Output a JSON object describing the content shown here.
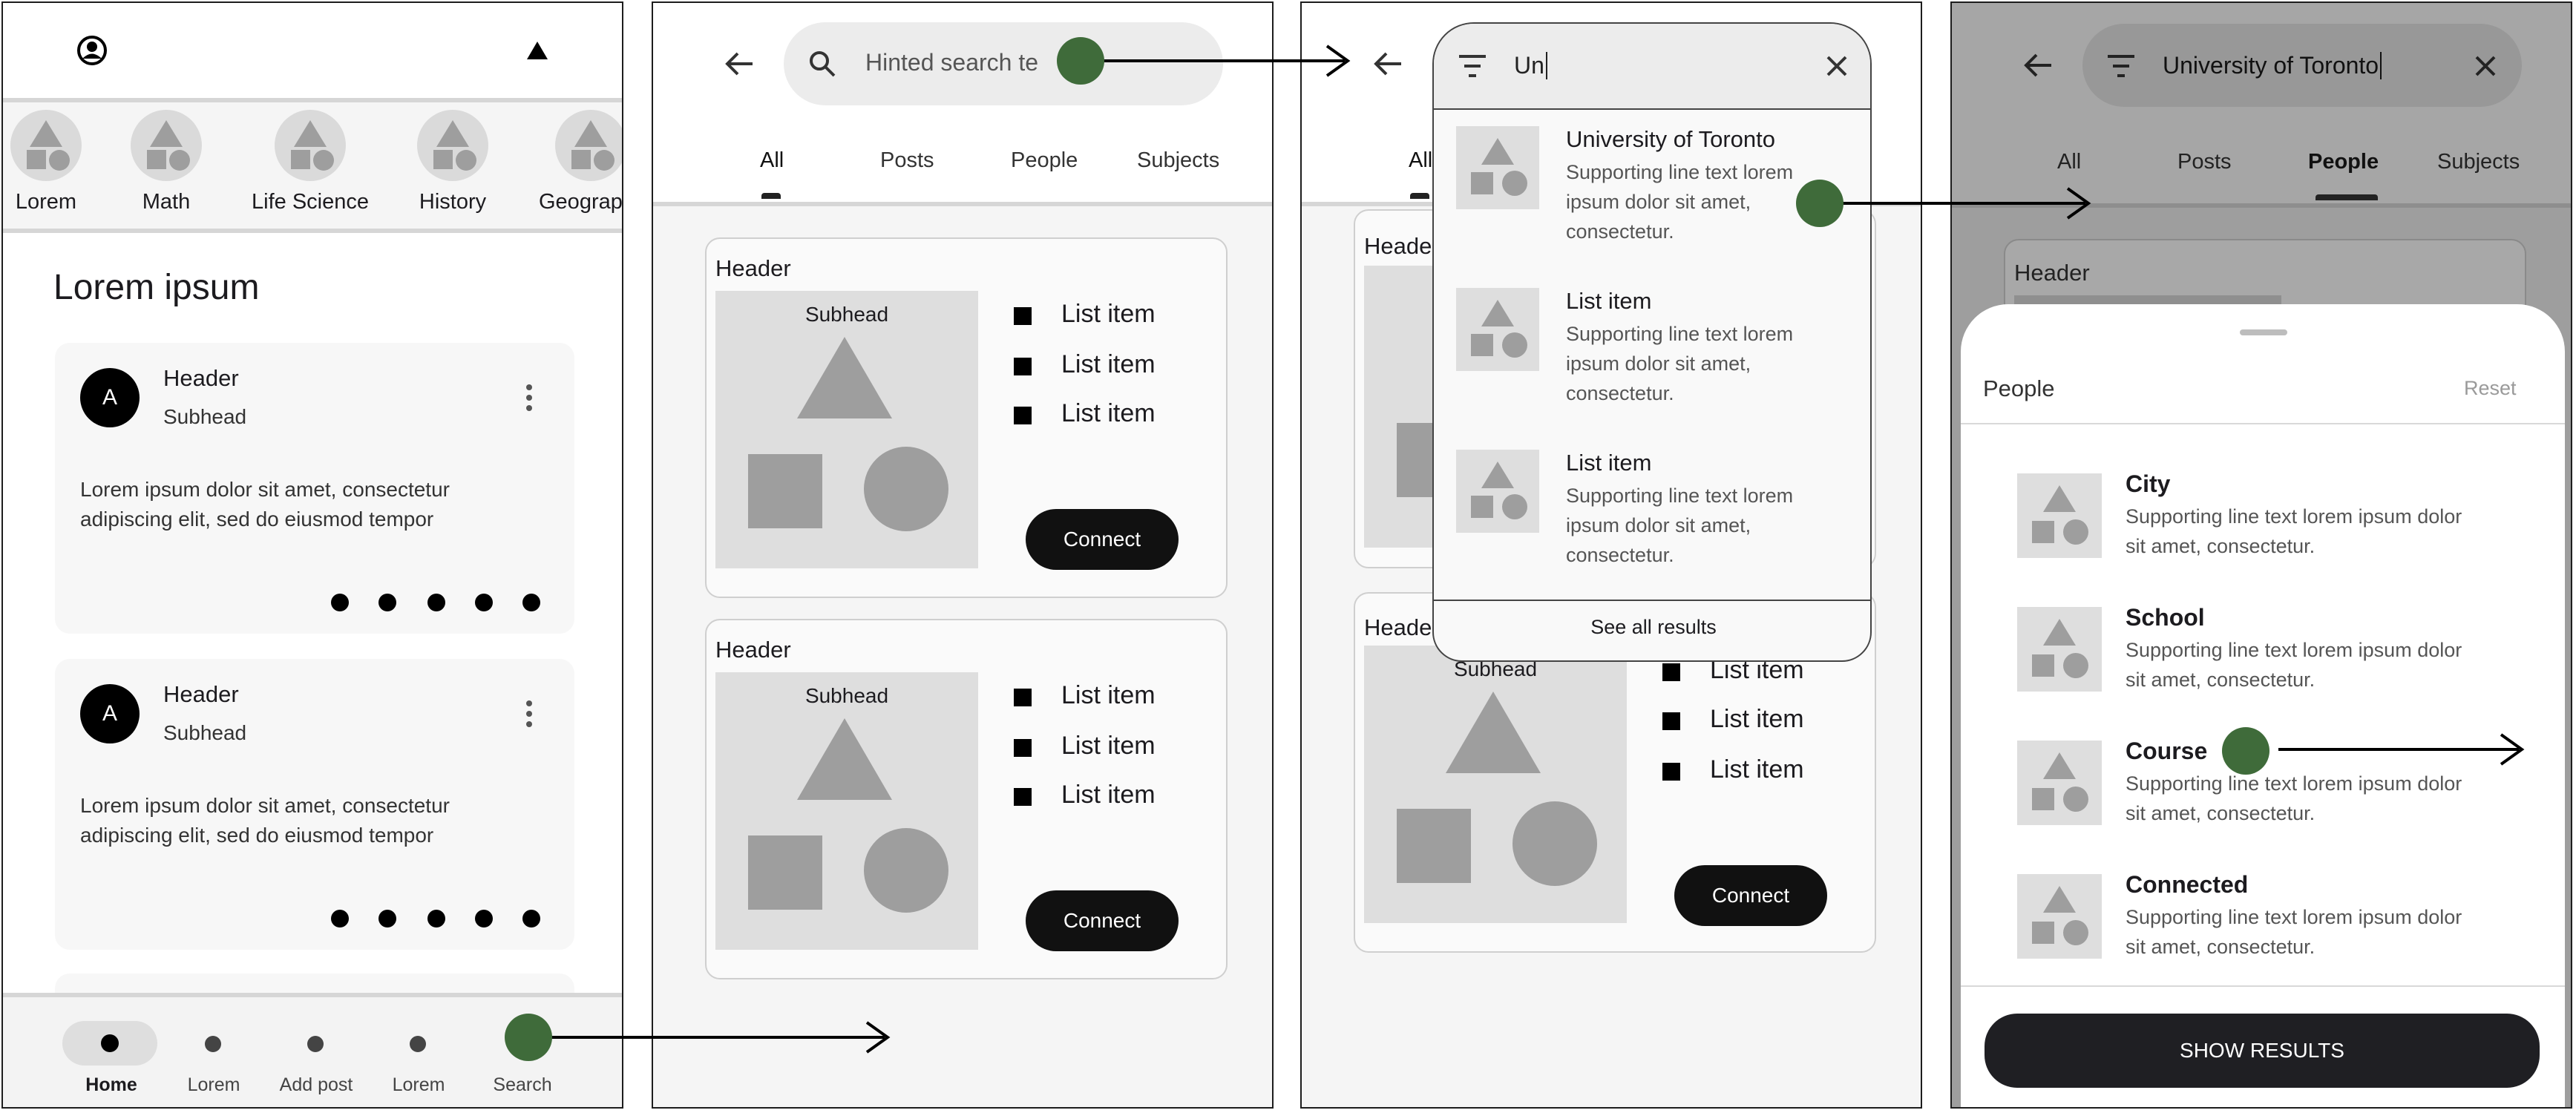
{
  "screen1": {
    "categories": [
      "Lorem",
      "Math",
      "Life Science",
      "History",
      "Geography"
    ],
    "section_title": "Lorem ipsum",
    "cards": [
      {
        "avatar": "A",
        "header": "Header",
        "subhead": "Subhead",
        "body_line1": "Lorem ipsum dolor sit amet, consectetur",
        "body_line2": "adipiscing elit, sed do eiusmod tempor"
      },
      {
        "avatar": "A",
        "header": "Header",
        "subhead": "Subhead",
        "body_line1": "Lorem ipsum dolor sit amet, consectetur",
        "body_line2": "adipiscing elit, sed do eiusmod tempor"
      }
    ],
    "nav": [
      "Home",
      "Lorem",
      "Add post",
      "Lorem",
      "Search"
    ]
  },
  "screen2": {
    "search_placeholder": "Hinted search te",
    "tabs": [
      "All",
      "Posts",
      "People",
      "Subjects"
    ],
    "cards": [
      {
        "header": "Header",
        "subhead": "Subhead",
        "items": [
          "List item",
          "List item",
          "List item"
        ],
        "button": "Connect"
      },
      {
        "header": "Header",
        "subhead": "Subhead",
        "items": [
          "List item",
          "List item",
          "List item"
        ],
        "button": "Connect"
      }
    ]
  },
  "screen3": {
    "search_value": "Un",
    "tab_partial": "All",
    "suggestions": [
      {
        "title": "University of Toronto",
        "line1": "Supporting line text lorem",
        "line2": "ipsum dolor sit amet,",
        "line3": "consectetur."
      },
      {
        "title": "List item",
        "line1": "Supporting line text lorem",
        "line2": "ipsum dolor sit amet,",
        "line3": "consectetur."
      },
      {
        "title": "List item",
        "line1": "Supporting line text lorem",
        "line2": "ipsum dolor sit amet,",
        "line3": "consectetur."
      }
    ],
    "see_all": "See all results",
    "bg_header1": "Heade",
    "bg_header2": "Heade",
    "bg_subhead": "Subhead",
    "bg_items": [
      "List item",
      "List item",
      "List item"
    ],
    "bg_button": "Connect"
  },
  "screen4": {
    "search_value": "University of Toronto",
    "tabs": [
      "All",
      "Posts",
      "People",
      "Subjects"
    ],
    "bg_header": "Header",
    "sheet_title": "People",
    "reset": "Reset",
    "options": [
      {
        "title": "City",
        "line1": "Supporting line text lorem ipsum dolor",
        "line2": "sit amet, consectetur."
      },
      {
        "title": "School",
        "line1": "Supporting line text lorem ipsum dolor",
        "line2": "sit amet, consectetur."
      },
      {
        "title": "Course",
        "line1": "Supporting line text lorem ipsum dolor",
        "line2": "sit amet, consectetur."
      },
      {
        "title": "Connected",
        "line1": "Supporting line text lorem ipsum dolor",
        "line2": "sit amet, consectetur."
      }
    ],
    "show_results": "SHOW RESULTS"
  },
  "colors": {
    "accent_dot": "#3f6b3a",
    "black": "#111111",
    "thumb": "#dedede",
    "shape": "#9e9e9e"
  }
}
